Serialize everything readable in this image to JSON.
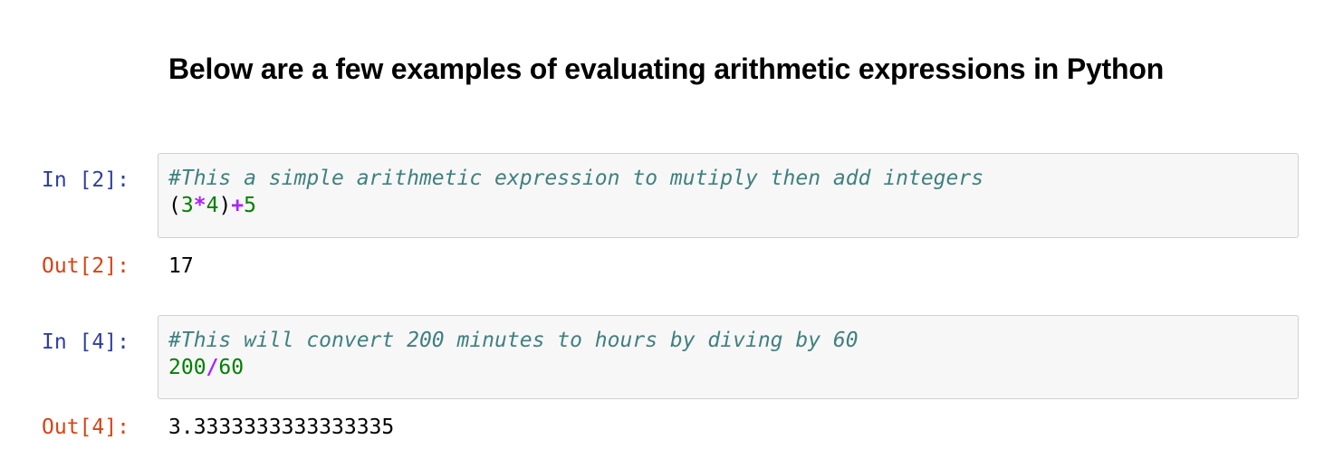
{
  "heading": "Below are a few examples of evaluating arithmetic expressions in Python",
  "cells": [
    {
      "in_prompt": "In [2]:",
      "comment": "#This a simple arithmetic expression to mutiply then add integers",
      "code_tokens": {
        "open_paren": "(",
        "num1": "3",
        "op1": "*",
        "num2": "4",
        "close_paren": ")",
        "op2": "+",
        "num3": "5"
      },
      "out_prompt": "Out[2]:",
      "output": "17"
    },
    {
      "in_prompt": "In [4]:",
      "comment": "#This will convert 200 minutes to hours by diving by 60",
      "code_tokens": {
        "num1": "200",
        "op1": "/",
        "num2": "60"
      },
      "out_prompt": "Out[4]:",
      "output": "3.3333333333333335"
    }
  ],
  "colors": {
    "in_prompt": "#303f9f",
    "out_prompt": "#d84315",
    "comment": "#408080",
    "number": "#008000",
    "operator": "#aa22ff",
    "cell_background": "#f7f7f7",
    "cell_border": "#cfcfcf"
  }
}
